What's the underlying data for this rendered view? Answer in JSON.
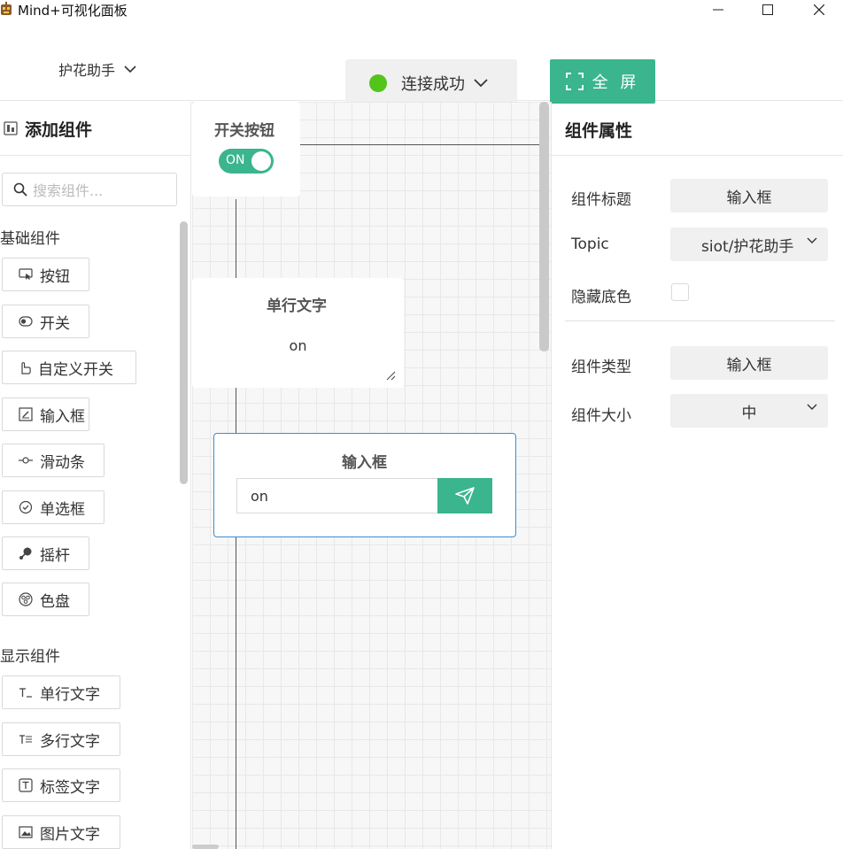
{
  "window": {
    "title": "Mind+可视化面板"
  },
  "header": {
    "project_name": "护花助手",
    "connection_status": "连接成功",
    "connection_color": "#52c41a",
    "fullscreen_label": "全 屏",
    "accent": "#3ab58d"
  },
  "left_panel": {
    "title": "添加组件",
    "search_placeholder": "搜索组件...",
    "basic_group": "基础组件",
    "basic_items": [
      "按钮",
      "开关",
      "自定义开关",
      "输入框",
      "滑动条",
      "单选框",
      "摇杆",
      "色盘"
    ],
    "display_group": "显示组件",
    "display_items": [
      "单行文字",
      "多行文字",
      "标签文字",
      "图片文字"
    ]
  },
  "canvas": {
    "switch_widget": {
      "title": "开关按钮",
      "state": "ON"
    },
    "text_widget": {
      "title": "单行文字",
      "value": "on"
    },
    "input_widget": {
      "title": "输入框",
      "value": "on"
    }
  },
  "right_panel": {
    "title": "组件属性",
    "title_label": "组件标题",
    "title_value": "输入框",
    "topic_label": "Topic",
    "topic_value": "siot/护花助手",
    "hide_bg_label": "隐藏底色",
    "type_label": "组件类型",
    "type_value": "输入框",
    "size_label": "组件大小",
    "size_value": "中"
  }
}
